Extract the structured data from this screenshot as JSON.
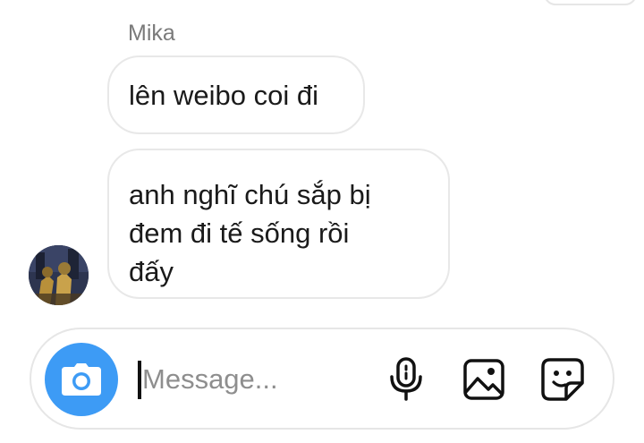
{
  "thread": {
    "sender_name": "Mika",
    "messages": [
      {
        "text": "lên weibo coi đi"
      },
      {
        "lines": [
          "anh nghĩ chú sắp bị",
          "đem đi tế sống rồi",
          "đấy"
        ]
      }
    ]
  },
  "composer": {
    "placeholder": "Message..."
  },
  "icons": {
    "camera": "camera-icon",
    "microphone": "microphone-icon",
    "gallery": "gallery-icon",
    "sticker": "sticker-icon"
  },
  "colors": {
    "camera_button": "#3d9bf5",
    "bubble_border": "#e8e8e8",
    "sender_name": "#7a7a7a",
    "placeholder": "#8e8e8e"
  }
}
